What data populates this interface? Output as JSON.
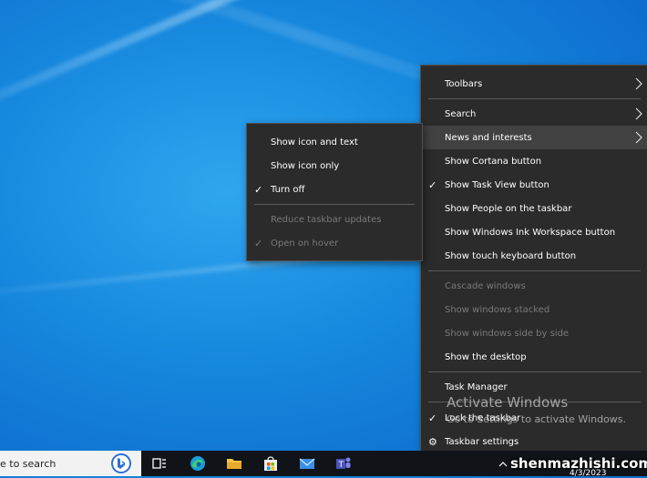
{
  "main_menu": {
    "items": [
      {
        "label": "Toolbars",
        "has_submenu": true,
        "checked": false,
        "disabled": false
      },
      {
        "label": "Search",
        "has_submenu": true,
        "checked": false,
        "disabled": false
      },
      {
        "label": "News and interests",
        "has_submenu": true,
        "checked": false,
        "disabled": false,
        "highlighted": true
      },
      {
        "label": "Show Cortana button",
        "checked": false,
        "disabled": false
      },
      {
        "label": "Show Task View button",
        "checked": true,
        "disabled": false
      },
      {
        "label": "Show People on the taskbar",
        "checked": false,
        "disabled": false
      },
      {
        "label": "Show Windows Ink Workspace button",
        "checked": false,
        "disabled": false
      },
      {
        "label": "Show touch keyboard button",
        "checked": false,
        "disabled": false
      },
      {
        "label": "Cascade windows",
        "checked": false,
        "disabled": true
      },
      {
        "label": "Show windows stacked",
        "checked": false,
        "disabled": true
      },
      {
        "label": "Show windows side by side",
        "checked": false,
        "disabled": true
      },
      {
        "label": "Show the desktop",
        "checked": false,
        "disabled": false
      },
      {
        "label": "Task Manager",
        "checked": false,
        "disabled": false
      },
      {
        "label": "Lock the taskbar",
        "checked": true,
        "disabled": false
      },
      {
        "label": "Taskbar settings",
        "icon": "gear-icon",
        "disabled": false
      }
    ]
  },
  "sub_menu": {
    "items": [
      {
        "label": "Show icon and text",
        "checked": false,
        "disabled": false
      },
      {
        "label": "Show icon only",
        "checked": false,
        "disabled": false
      },
      {
        "label": "Turn off",
        "checked": true,
        "disabled": false
      },
      {
        "label": "Reduce taskbar updates",
        "checked": false,
        "disabled": true
      },
      {
        "label": "Open on hover",
        "checked": true,
        "disabled": true
      }
    ]
  },
  "watermark": {
    "title": "Activate Windows",
    "subtitle": "Go to Settings to activate Windows."
  },
  "taskbar": {
    "search_placeholder": "e to search",
    "apps": [
      "task-view-icon",
      "edge-icon",
      "file-explorer-icon",
      "store-icon",
      "mail-icon",
      "teams-icon"
    ],
    "date": "4/3/2023"
  },
  "overlay": {
    "site_watermark": "shenmazhishi.com"
  },
  "colors": {
    "menu_bg": "#2b2b2b",
    "menu_highlight": "#414141",
    "disabled_text": "#7a7a7a",
    "taskbar_bg": "#101418"
  },
  "glyphs": {
    "check": "✓",
    "gear": "⚙"
  }
}
